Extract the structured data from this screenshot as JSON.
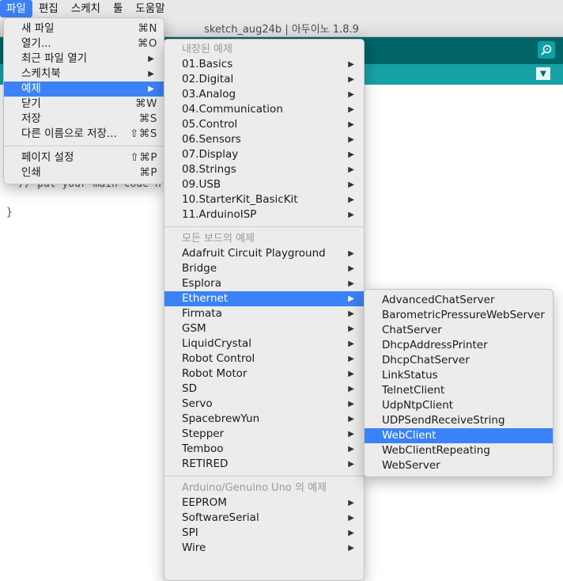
{
  "menubar": [
    "파일",
    "편집",
    "스케치",
    "툴",
    "도움말"
  ],
  "window": {
    "title": "sketch_aug24b | 아두이노 1.8.9"
  },
  "editor": {
    "line_comment": "  // put your main code h",
    "line_brace": "}"
  },
  "file_menu": {
    "items": [
      {
        "label": "새 파일",
        "shortcut": "⌘N"
      },
      {
        "label": "열기...",
        "shortcut": "⌘O"
      },
      {
        "label": "최근 파일 열기"
      },
      {
        "label": "스케치북"
      },
      {
        "label": "예제"
      },
      {
        "label": "닫기",
        "shortcut": "⌘W"
      },
      {
        "label": "저장",
        "shortcut": "⌘S"
      },
      {
        "label": "다른 이름으로 저장...",
        "shortcut": "⇧⌘S"
      },
      {
        "label": "페이지 설정",
        "shortcut": "⇧⌘P"
      },
      {
        "label": "인쇄",
        "shortcut": "⌘P"
      }
    ]
  },
  "examples_menu": {
    "builtin_header": "내장된 예제",
    "builtin": [
      "01.Basics",
      "02.Digital",
      "03.Analog",
      "04.Communication",
      "05.Control",
      "06.Sensors",
      "07.Display",
      "08.Strings",
      "09.USB",
      "10.StarterKit_BasicKit",
      "11.ArduinoISP"
    ],
    "all_boards_header": "모든 보드의 예제",
    "all_boards": [
      "Adafruit Circuit Playground",
      "Bridge",
      "Esplora",
      "Ethernet",
      "Firmata",
      "GSM",
      "LiquidCrystal",
      "Robot Control",
      "Robot Motor",
      "SD",
      "Servo",
      "SpacebrewYun",
      "Stepper",
      "Temboo",
      "RETIRED"
    ],
    "board_header": "Arduino/Genuino Uno 의 예제",
    "board": [
      "EEPROM",
      "SoftwareSerial",
      "SPI",
      "Wire"
    ]
  },
  "ethernet_menu": {
    "items": [
      "AdvancedChatServer",
      "BarometricPressureWebServer",
      "ChatServer",
      "DhcpAddressPrinter",
      "DhcpChatServer",
      "LinkStatus",
      "TelnetClient",
      "UdpNtpClient",
      "UDPSendReceiveString",
      "WebClient",
      "WebClientRepeating",
      "WebServer"
    ],
    "highlighted": "WebClient"
  },
  "icons": {
    "submenu_arrow": "right-triangle-icon",
    "serial_monitor": "magnifier-icon",
    "tab_menu": "down-triangle-icon"
  },
  "colors": {
    "highlight": "#3b82f7",
    "toolbar": "#006468",
    "tabbar": "#17a1a5"
  }
}
